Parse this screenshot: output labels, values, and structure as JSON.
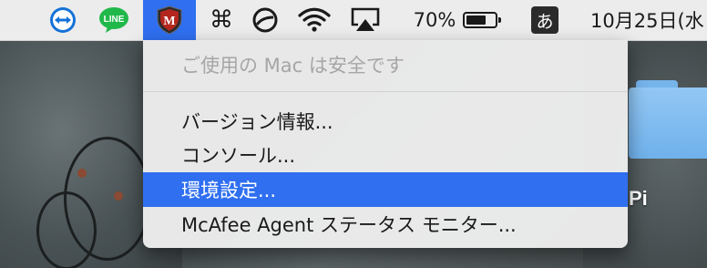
{
  "menubar": {
    "icons": [
      {
        "name": "teamviewer-icon"
      },
      {
        "name": "line-icon",
        "label": "LINE"
      },
      {
        "name": "mcafee-icon",
        "label": "M"
      },
      {
        "name": "command-icon",
        "glyph": "⌘"
      },
      {
        "name": "sync-icon"
      },
      {
        "name": "wifi-icon"
      },
      {
        "name": "airplay-icon"
      }
    ],
    "battery_text": "70%",
    "battery_level": 0.7,
    "input_method": "あ",
    "date": "10月25日(水"
  },
  "dropdown": {
    "status_text": "ご使用の Mac は安全です",
    "items": [
      {
        "label": "バージョン情報..."
      },
      {
        "label": "コンソール..."
      },
      {
        "label": "環境設定..."
      },
      {
        "label": "McAfee Agent ステータス モニター..."
      }
    ],
    "selected_index": 2
  },
  "desktop": {
    "label": "Pi"
  },
  "colors": {
    "accent": "#2f6ff0",
    "menubar_bg": "#ececec",
    "line_green": "#21b84a",
    "teamviewer_blue": "#1472d8",
    "mcafee_red": "#b3261e",
    "disabled_text": "#a6a6a6"
  }
}
